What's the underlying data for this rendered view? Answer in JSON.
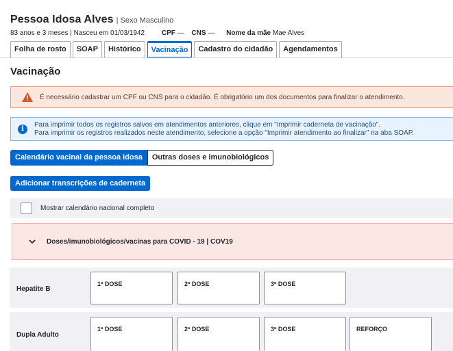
{
  "patient": {
    "name": "Pessoa Idosa Alves",
    "sex": "| Sexo Masculino",
    "age_birth": "83 anos e 3 meses | Nasceu em 01/03/1942",
    "cpf_label": "CPF",
    "cpf_value": "—",
    "cns_label": "CNS",
    "cns_value": "—",
    "mother_label": "Nome da mãe",
    "mother_value": "Mae Alves"
  },
  "tabs": [
    {
      "label": "Folha de rosto",
      "active": false
    },
    {
      "label": "SOAP",
      "active": false
    },
    {
      "label": "Histórico",
      "active": false
    },
    {
      "label": "Vacinação",
      "active": true
    },
    {
      "label": "Cadastro do cidadão",
      "active": false
    },
    {
      "label": "Agendamentos",
      "active": false
    }
  ],
  "section_title": "Vacinação",
  "warning": {
    "icon": "warning-triangle-icon",
    "text": "É necessário cadastrar um CPF ou CNS para o cidadão. É obrigatório um dos documentos para finalizar o atendimento."
  },
  "info": {
    "icon": "info-circle-icon",
    "line1": "Para imprimir todos os registros salvos em atendimentos anteriores, clique em \"Imprimir caderneta de vacinação\".",
    "line2": "Para imprimir os registros realizados neste atendimento, selecione a opção \"Imprimir atendimento ao finalizar\" na aba SOAP."
  },
  "segments": {
    "calendar": "Calendário vacinal da pessoa idosa",
    "others": "Outras doses e imunobiológicos"
  },
  "add_button": "Adicionar transcrições de caderneta",
  "checkbox_label": "Mostrar calendário nacional completo",
  "covid": {
    "icon": "chevron-down-icon",
    "label": "Doses/imunobiológicos/vacinas para COVID - 19 | COV19"
  },
  "vaccines": [
    {
      "name": "Hepatite B",
      "doses": [
        "1ª DOSE",
        "2ª DOSE",
        "3ª DOSE"
      ]
    },
    {
      "name": "Dupla Adulto",
      "doses": [
        "1ª DOSE",
        "2ª DOSE",
        "3ª DOSE",
        "REFORÇO"
      ]
    }
  ],
  "colors": {
    "primary": "#0069d0",
    "warning_bg": "#fbe7dd",
    "info_bg": "#e8f3ff",
    "row_bg": "#f0f0f5"
  }
}
